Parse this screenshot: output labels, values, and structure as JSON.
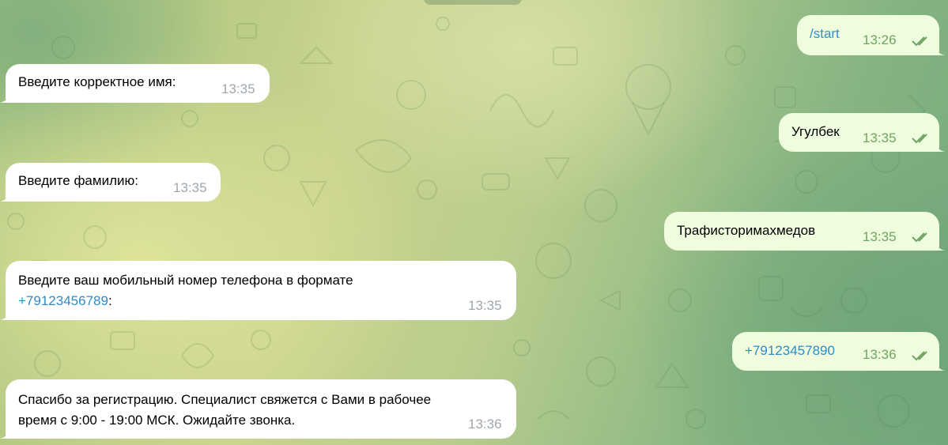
{
  "incoming": [
    {
      "text": "Введите корректное имя:",
      "time": "13:35"
    },
    {
      "text": "Введите фамилию:",
      "time": "13:35"
    },
    {
      "text": "Введите ваш мобильный номер телефона в формате",
      "link": "+79123456789",
      "suffix": ":",
      "time": "13:35"
    },
    {
      "line1": "Спасибо за регистрацию. Специалист свяжется с Вами в рабочее",
      "line2": "время с 9:00 - 19:00 МСК. Ожидайте звонка.",
      "time": "13:36"
    }
  ],
  "outgoing": [
    {
      "text": "/start",
      "time": "13:26"
    },
    {
      "text": "Угулбек",
      "time": "13:35"
    },
    {
      "text": "Трафисторимахмедов",
      "time": "13:35"
    },
    {
      "text": "+79123457890",
      "time": "13:36"
    }
  ],
  "colors": {
    "incoming_bubble": "#ffffff",
    "outgoing_bubble": "#effdde",
    "link": "#2e8bc9",
    "outgoing_time": "#6fa564",
    "incoming_time": "#a0a7ad"
  }
}
